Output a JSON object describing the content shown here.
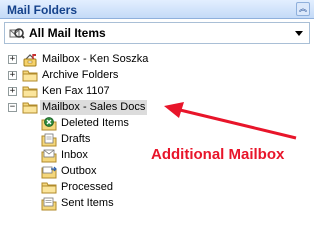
{
  "pane": {
    "title": "Mail Folders"
  },
  "all_mail": {
    "label": "All Mail Items"
  },
  "tree": [
    {
      "label": "Mailbox - Ken Soszka",
      "expander": "+",
      "icon": "mailbox-icon"
    },
    {
      "label": "Archive Folders",
      "expander": "+",
      "icon": "folder-icon"
    },
    {
      "label": "Ken Fax 1107",
      "expander": "+",
      "icon": "folder-icon"
    },
    {
      "label": "Mailbox - Sales Docs",
      "expander": "−",
      "icon": "folder-icon",
      "selected": true
    }
  ],
  "subfolders": [
    {
      "label": "Deleted Items",
      "icon": "deleted-items-icon"
    },
    {
      "label": "Drafts",
      "icon": "drafts-icon"
    },
    {
      "label": "Inbox",
      "icon": "inbox-icon"
    },
    {
      "label": "Outbox",
      "icon": "outbox-icon"
    },
    {
      "label": "Processed",
      "icon": "folder-icon"
    },
    {
      "label": "Sent Items",
      "icon": "sent-items-icon"
    }
  ],
  "annotation": {
    "text": "Additional Mailbox",
    "color": "#e8152a"
  },
  "colors": {
    "header_text": "#15428b",
    "header_bg": "#c4daf7",
    "selection": "#dcdcdc"
  }
}
